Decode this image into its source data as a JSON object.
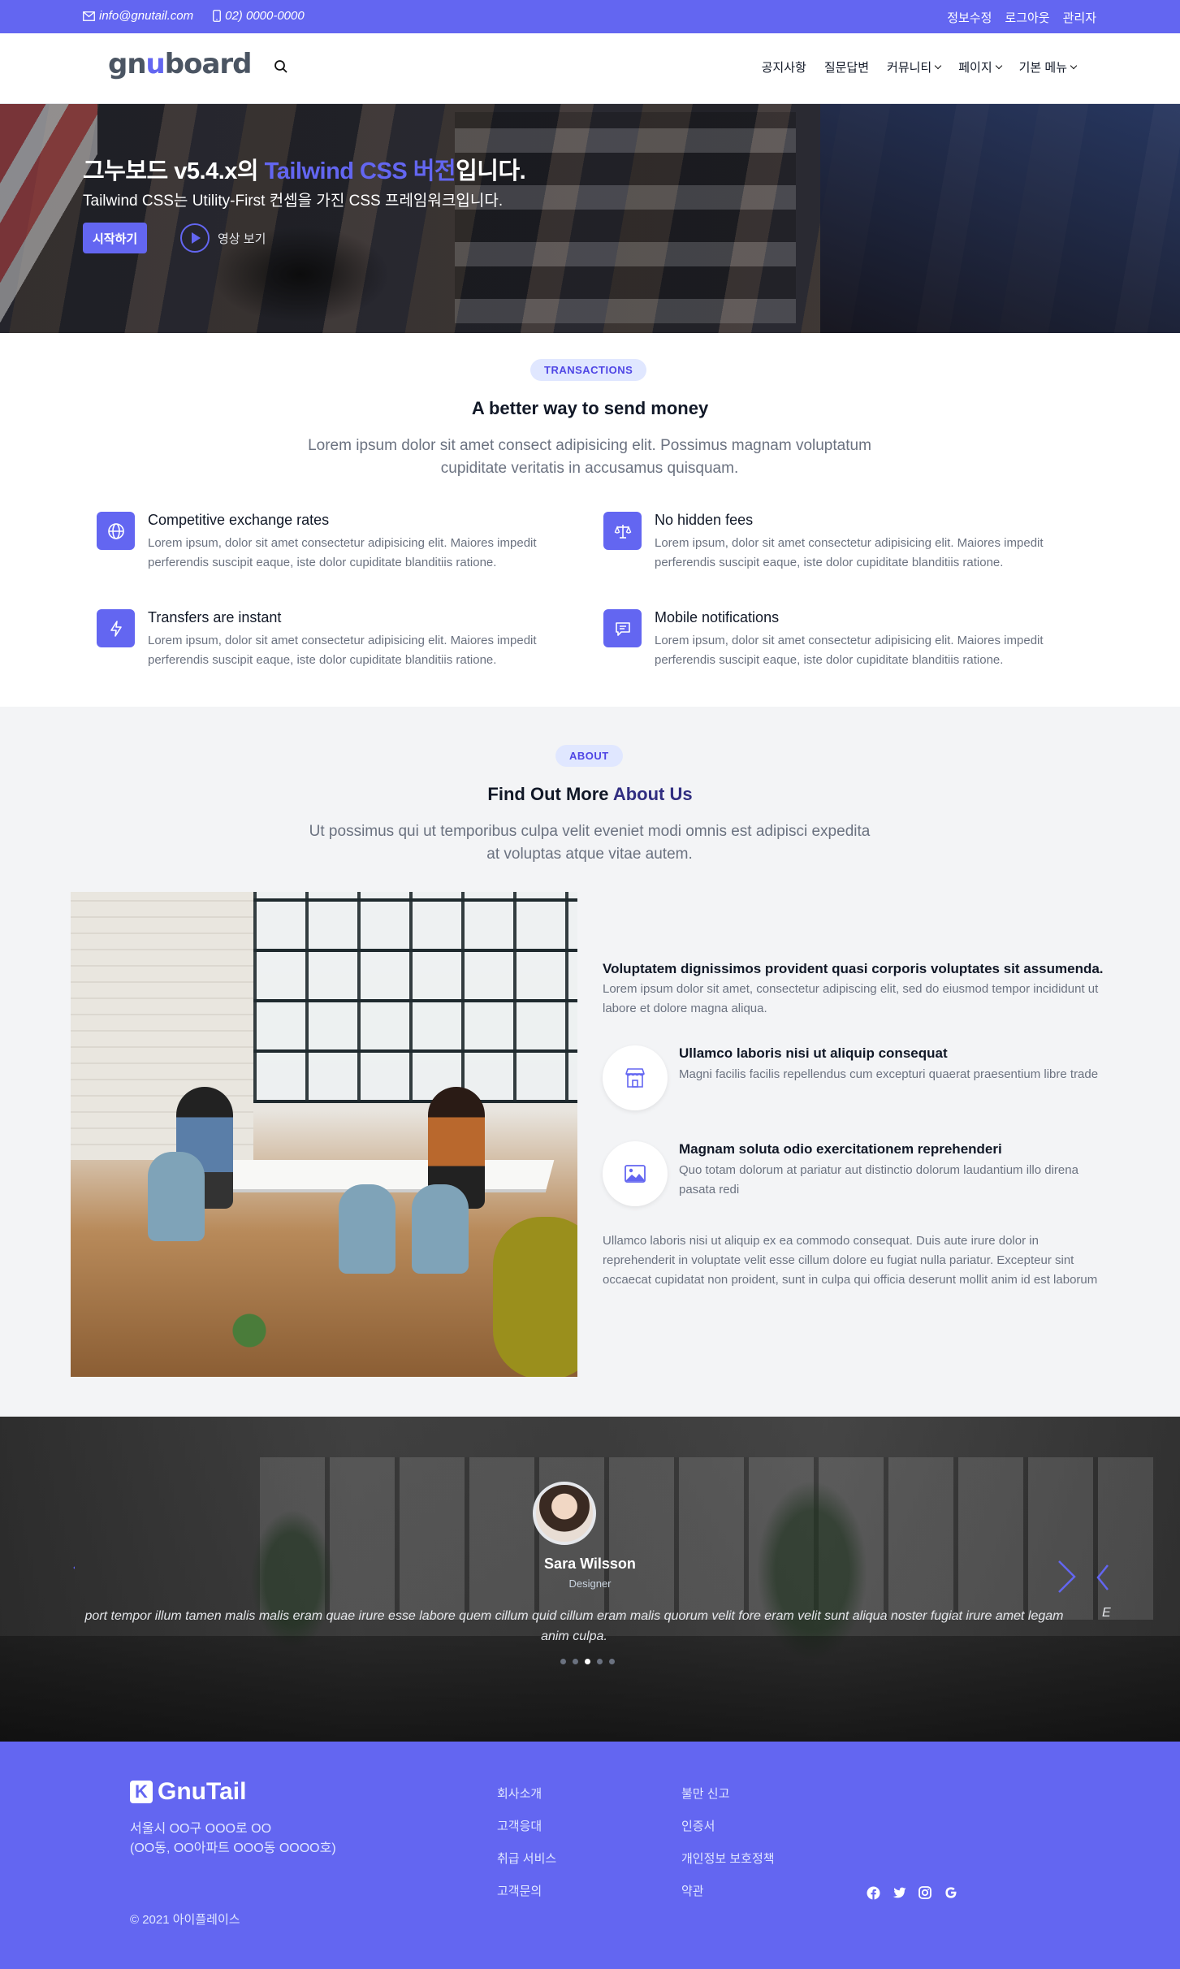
{
  "topbar": {
    "email": "info@gnutail.com",
    "phone": "02) 0000-0000",
    "links": [
      "정보수정",
      "로그아웃",
      "관리자"
    ]
  },
  "header": {
    "logo_pre": "gn",
    "logo_accent": "u",
    "logo_post": "board",
    "nav": [
      "공지사항",
      "질문답변",
      "커뮤니티",
      "페이지",
      "기본 메뉴"
    ]
  },
  "hero": {
    "title_pre": "그누보드 v5.4.x의 ",
    "title_accent": "Tailwind CSS 버전",
    "title_post": "입니다.",
    "subtitle": "Tailwind CSS는 Utility-First 컨셉을 가진 CSS 프레임워크입니다.",
    "start_label": "시작하기",
    "video_label": "영상 보기"
  },
  "transactions": {
    "pill": "TRANSACTIONS",
    "title": "A better way to send money",
    "lead": "Lorem ipsum dolor sit amet consect adipisicing elit. Possimus magnam voluptatum cupiditate veritatis in accusamus quisquam.",
    "features": [
      {
        "icon": "globe-icon",
        "title": "Competitive exchange rates",
        "text": "Lorem ipsum, dolor sit amet consectetur adipisicing elit. Maiores impedit perferendis suscipit eaque, iste dolor cupiditate blanditiis ratione."
      },
      {
        "icon": "scale-icon",
        "title": "No hidden fees",
        "text": "Lorem ipsum, dolor sit amet consectetur adipisicing elit. Maiores impedit perferendis suscipit eaque, iste dolor cupiditate blanditiis ratione."
      },
      {
        "icon": "lightning-icon",
        "title": "Transfers are instant",
        "text": "Lorem ipsum, dolor sit amet consectetur adipisicing elit. Maiores impedit perferendis suscipit eaque, iste dolor cupiditate blanditiis ratione."
      },
      {
        "icon": "chat-icon",
        "title": "Mobile notifications",
        "text": "Lorem ipsum, dolor sit amet consectetur adipisicing elit. Maiores impedit perferendis suscipit eaque, iste dolor cupiditate blanditiis ratione."
      }
    ]
  },
  "about": {
    "pill": "ABOUT",
    "title_pre": "Find Out More ",
    "title_accent": "About Us",
    "lead": "Ut possimus qui ut temporibus culpa velit eveniet modi omnis est adipisci expedita at voluptas atque vitae autem.",
    "right_title": "Voluptatem dignissimos provident quasi corporis voluptates sit assumenda.",
    "right_text": "Lorem ipsum dolor sit amet, consectetur adipiscing elit, sed do eiusmod tempor incididunt ut labore et dolore magna aliqua.",
    "items": [
      {
        "icon": "store-icon",
        "title": "Ullamco laboris nisi ut aliquip consequat",
        "text": "Magni facilis facilis repellendus cum excepturi quaerat praesentium libre trade"
      },
      {
        "icon": "image-icon",
        "title": "Magnam soluta odio exercitationem reprehenderi",
        "text": "Quo totam dolorum at pariatur aut distinctio dolorum laudantium illo direna pasata redi"
      }
    ],
    "paragraph": "Ullamco laboris nisi ut aliquip ex ea commodo consequat. Duis aute irure dolor in reprehenderit in voluptate velit esse cillum dolore eu fugiat nulla pariatur. Excepteur sint occaecat cupidatat non proident, sunt in culpa qui officia deserunt mollit anim id est laborum"
  },
  "testimonial": {
    "name": "Sara Wilsson",
    "role": "Designer",
    "quote": "port tempor illum tamen malis malis eram quae irure esse labore quem cillum quid cillum eram malis quorum velit fore eram velit sunt aliqua noster fugiat irure amet legam anim culpa.",
    "next_quote_fragment": "E",
    "slides": 5,
    "active_slide": 3
  },
  "footer": {
    "brand": "GnuTail",
    "brand_mark": "K",
    "address_line1": "서울시 OO구 OOO로 OO",
    "address_line2": "(OO동, OO아파트 OOO동 OOOO호)",
    "col1": [
      "회사소개",
      "고객응대",
      "취급 서비스",
      "고객문의"
    ],
    "col2": [
      "불만 신고",
      "인증서",
      "개인정보 보호정책",
      "약관"
    ],
    "social": [
      "facebook-icon",
      "twitter-icon",
      "instagram-icon",
      "google-icon"
    ],
    "copyright": "© 2021 아이플레이스"
  },
  "colors": {
    "accent": "#6366f1",
    "accent_dark": "#312e81",
    "pill_bg": "#e0e7ff",
    "section_bg": "#f3f4f6"
  }
}
